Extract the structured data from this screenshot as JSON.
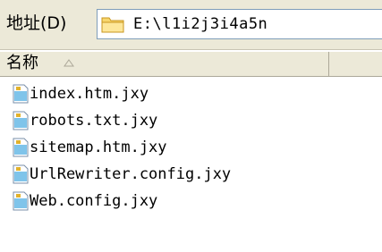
{
  "address_bar": {
    "label": "地址(D)",
    "value": "E:\\l1i2j3i4a5n",
    "folder_icon": "folder-icon"
  },
  "list_header": {
    "name_column": "名称",
    "sort_icon": "sort-ascending-icon"
  },
  "files": [
    {
      "name": "index.htm.jxy",
      "icon": "file-icon"
    },
    {
      "name": "robots.txt.jxy",
      "icon": "file-icon"
    },
    {
      "name": "sitemap.htm.jxy",
      "icon": "file-icon"
    },
    {
      "name": "UrlRewriter.config.jxy",
      "icon": "file-icon"
    },
    {
      "name": "Web.config.jxy",
      "icon": "file-icon"
    }
  ]
}
